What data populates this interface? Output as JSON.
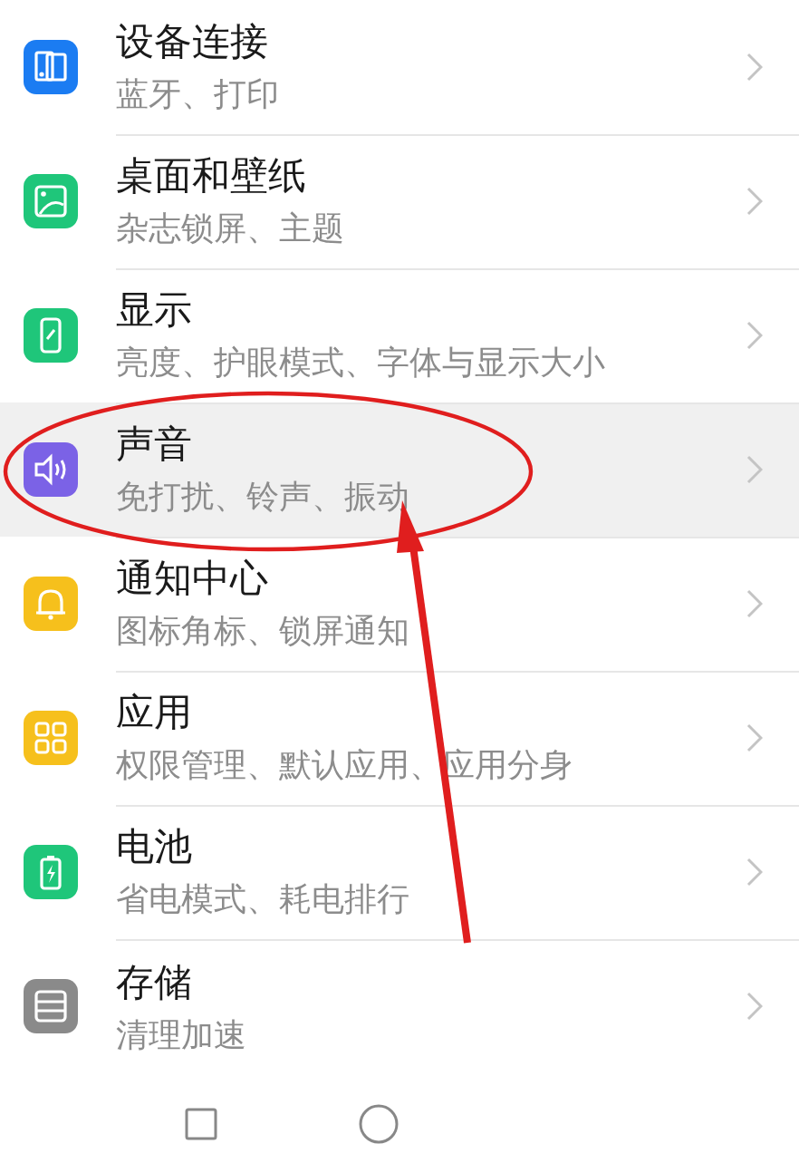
{
  "settings": [
    {
      "title": "设备连接",
      "subtitle": "蓝牙、打印",
      "color": "#1b7cf2",
      "highlighted": false,
      "circled": false
    },
    {
      "title": "桌面和壁纸",
      "subtitle": "杂志锁屏、主题",
      "color": "#1fc67a",
      "highlighted": false,
      "circled": false
    },
    {
      "title": "显示",
      "subtitle": "亮度、护眼模式、字体与显示大小",
      "color": "#1fc67a",
      "highlighted": false,
      "circled": false
    },
    {
      "title": "声音",
      "subtitle": "免打扰、铃声、振动",
      "color": "#7b62e6",
      "highlighted": true,
      "circled": true
    },
    {
      "title": "通知中心",
      "subtitle": "图标角标、锁屏通知",
      "color": "#f6c01c",
      "highlighted": false,
      "circled": false
    },
    {
      "title": "应用",
      "subtitle": "权限管理、默认应用、应用分身",
      "color": "#f6c01c",
      "highlighted": false,
      "circled": false
    },
    {
      "title": "电池",
      "subtitle": "省电模式、耗电排行",
      "color": "#1fc67a",
      "highlighted": false,
      "circled": false
    },
    {
      "title": "存储",
      "subtitle": "清理加速",
      "color": "#8a8a8a",
      "highlighted": false,
      "circled": false
    }
  ]
}
